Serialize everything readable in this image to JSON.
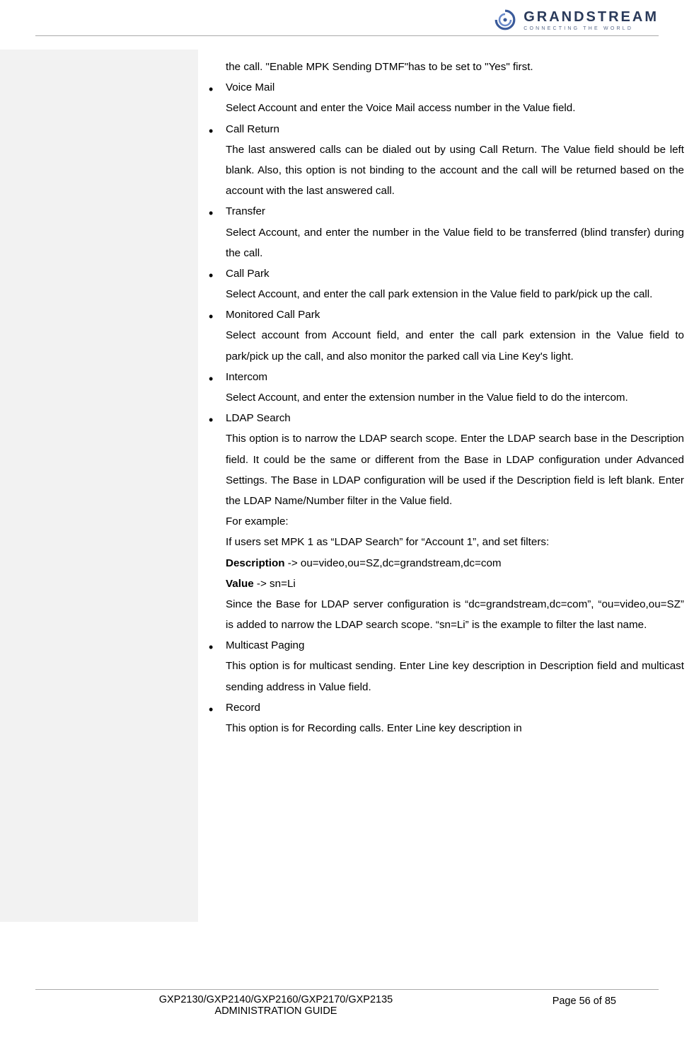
{
  "brand": {
    "name": "GRANDSTREAM",
    "tagline": "CONNECTING THE WORLD"
  },
  "continuationLine": "the call. \"Enable MPK Sending DTMF\"has to be set to \"Yes\" first.",
  "items": [
    {
      "title": "Voice Mail",
      "body": "Select Account and enter the Voice Mail access number in the Value field."
    },
    {
      "title": "Call Return",
      "body": "The last answered calls can be dialed out by using Call Return. The Value field should be left blank. Also, this option is not binding to the account and the call will be returned based on the account with the last answered call."
    },
    {
      "title": "Transfer",
      "body": "Select Account, and enter the number in the Value field to be transferred (blind transfer) during the call."
    },
    {
      "title": "Call Park",
      "body": "Select Account, and enter the call park extension in the Value field to park/pick up the call."
    },
    {
      "title": "Monitored Call Park",
      "body": "Select account from Account field, and enter the call park extension in the Value field to park/pick up the call, and also monitor the parked call via Line Key's light."
    },
    {
      "title": "Intercom",
      "body": "Select Account, and enter the extension number in the Value field to do the intercom."
    }
  ],
  "ldap": {
    "title": "LDAP Search",
    "para1": "This option is to narrow the LDAP search scope. Enter the LDAP search base in the Description field. It could be the same or different from the Base in LDAP configuration under Advanced Settings. The Base in LDAP configuration will be used if the Description field is left blank. Enter the LDAP Name/Number filter in the Value field.",
    "forExample": "For example:",
    "line2": "If users set MPK 1 as “LDAP Search” for “Account 1”, and set filters:",
    "descLabel": "Description",
    "descVal": " -> ou=video,ou=SZ,dc=grandstream,dc=com",
    "valueLabel": "Value",
    "valueVal": " -> sn=Li",
    "para2": "Since the Base for LDAP server configuration is “dc=grandstream,dc=com”, “ou=video,ou=SZ” is added to narrow the LDAP search scope. “sn=Li” is the example to filter the last name."
  },
  "multicast": {
    "title": "Multicast Paging",
    "body": "This option is for multicast sending. Enter Line key description in Description field and multicast sending address in Value field."
  },
  "record": {
    "title": "Record",
    "body": "This option is for Recording calls. Enter Line key description in"
  },
  "footer": {
    "left1": "GXP2130/GXP2140/GXP2160/GXP2170/GXP2135",
    "left2": "ADMINISTRATION GUIDE",
    "right": "Page 56 of 85"
  }
}
